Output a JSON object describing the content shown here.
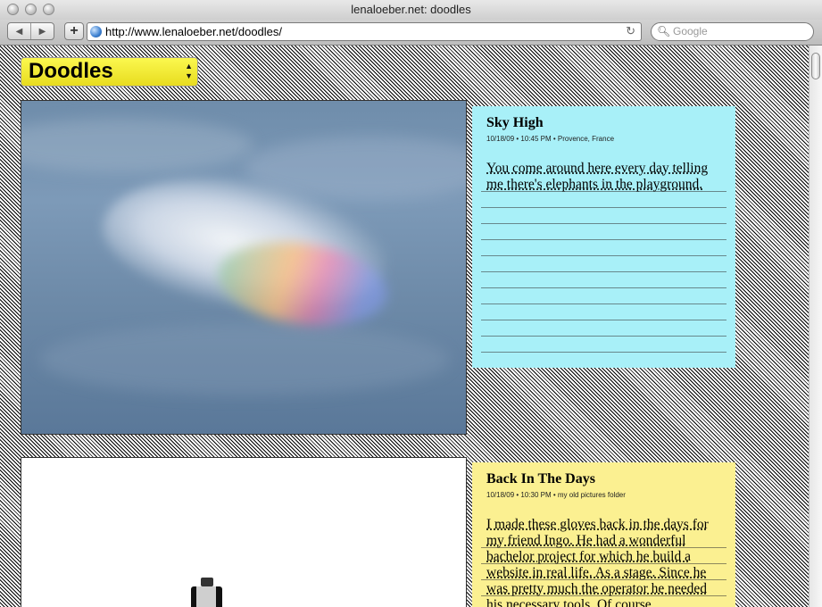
{
  "window": {
    "title": "lenaloeber.net: doodles"
  },
  "toolbar": {
    "back_icon": "back-arrow-icon",
    "forward_icon": "forward-arrow-icon",
    "add_label": "+",
    "url": "http://www.lenaloeber.net/doodles/",
    "search_placeholder": "Google"
  },
  "page": {
    "select": {
      "value": "Doodles",
      "accent": "#f6ee2c"
    },
    "posts": [
      {
        "title": "Sky High",
        "meta": "10/18/09 • 10:45 PM • Provence, France",
        "body": "You come around here every day telling me there's elephants in the playground.",
        "color": "#a8f0f8"
      },
      {
        "title": "Back In The Days",
        "meta": "10/18/09 • 10:30 PM • my old pictures folder",
        "body": "I made these gloves back in the days for my friend Ingo. He had a wonderful bachelor project for which he build a website in real life. As a stage. Since he was pretty much the operator he needed his necessary tools. Of course",
        "color": "#fbf091"
      }
    ]
  }
}
